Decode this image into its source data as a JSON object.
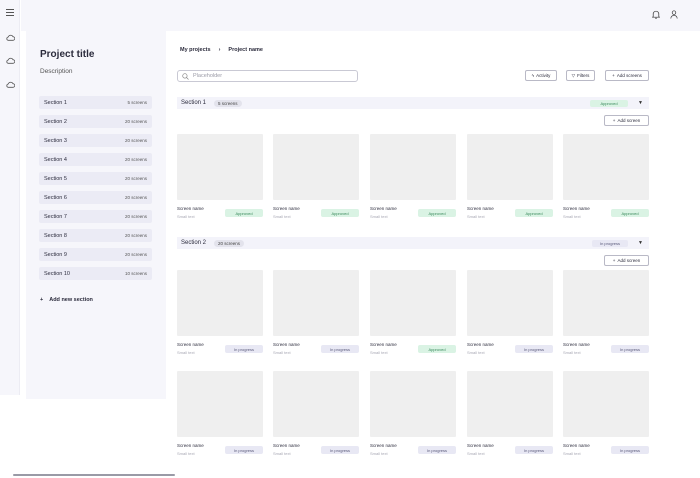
{
  "rail": {
    "icons": [
      "menu-icon",
      "cloud-sync-icon",
      "cloud-sync-icon",
      "cloud-sync-icon"
    ]
  },
  "topbar": {
    "icons": [
      "bell-icon",
      "user-icon"
    ]
  },
  "project": {
    "title": "Project title",
    "description": "Description",
    "sections": [
      {
        "label": "Section 1",
        "count": "5 screens"
      },
      {
        "label": "Section 2",
        "count": "20 screens"
      },
      {
        "label": "Section 3",
        "count": "20 screens"
      },
      {
        "label": "Section 4",
        "count": "20 screens"
      },
      {
        "label": "Section 5",
        "count": "20 screens"
      },
      {
        "label": "Section 6",
        "count": "20 screens"
      },
      {
        "label": "Section 7",
        "count": "20 screens"
      },
      {
        "label": "Section 8",
        "count": "20 screens"
      },
      {
        "label": "Section 9",
        "count": "20 screens"
      },
      {
        "label": "Section 10",
        "count": "10 screens"
      }
    ],
    "add_section": "Add new section"
  },
  "breadcrumb": {
    "root": "My projects",
    "separator": "›",
    "current": "Project name"
  },
  "search": {
    "placeholder": "Placeholder"
  },
  "toolbar": {
    "activity": "Activity",
    "filters": "Filters",
    "add_screens": "Add screens"
  },
  "main_sections": [
    {
      "label": "Section 1",
      "count": "5 screens",
      "status": "Approved",
      "add_screen": "Add screen",
      "rows": [
        [
          {
            "name": "Screen name",
            "text": "Small text",
            "status": "Approved"
          },
          {
            "name": "Screen name",
            "text": "Small text",
            "status": "Approved"
          },
          {
            "name": "Screen name",
            "text": "Small text",
            "status": "Approved"
          },
          {
            "name": "Screen name",
            "text": "Small text",
            "status": "Approved"
          },
          {
            "name": "Screen name",
            "text": "Small text",
            "status": "Approved"
          }
        ]
      ]
    },
    {
      "label": "Section 2",
      "count": "20 screens",
      "status": "In progress",
      "add_screen": "Add screen",
      "rows": [
        [
          {
            "name": "Screen name",
            "text": "Small text",
            "status": "In progress"
          },
          {
            "name": "Screen name",
            "text": "Small text",
            "status": "In progress"
          },
          {
            "name": "Screen name",
            "text": "Small text",
            "status": "Approved"
          },
          {
            "name": "Screen name",
            "text": "Small text",
            "status": "In progress"
          },
          {
            "name": "Screen name",
            "text": "Small text",
            "status": "In progress"
          }
        ],
        [
          {
            "name": "Screen name",
            "text": "Small text",
            "status": "In progress"
          },
          {
            "name": "Screen name",
            "text": "Small text",
            "status": "In progress"
          },
          {
            "name": "Screen name",
            "text": "Small text",
            "status": "In progress"
          },
          {
            "name": "Screen name",
            "text": "Small text",
            "status": "In progress"
          },
          {
            "name": "Screen name",
            "text": "Small text",
            "status": "In progress"
          }
        ]
      ]
    }
  ],
  "colors": {
    "approved_bg": "#daf3e4",
    "approved_text": "#3a8a5c",
    "inprogress_bg": "#e8e8f4",
    "inprogress_text": "#5a5a7a",
    "panel_bg": "#f6f6fb"
  }
}
